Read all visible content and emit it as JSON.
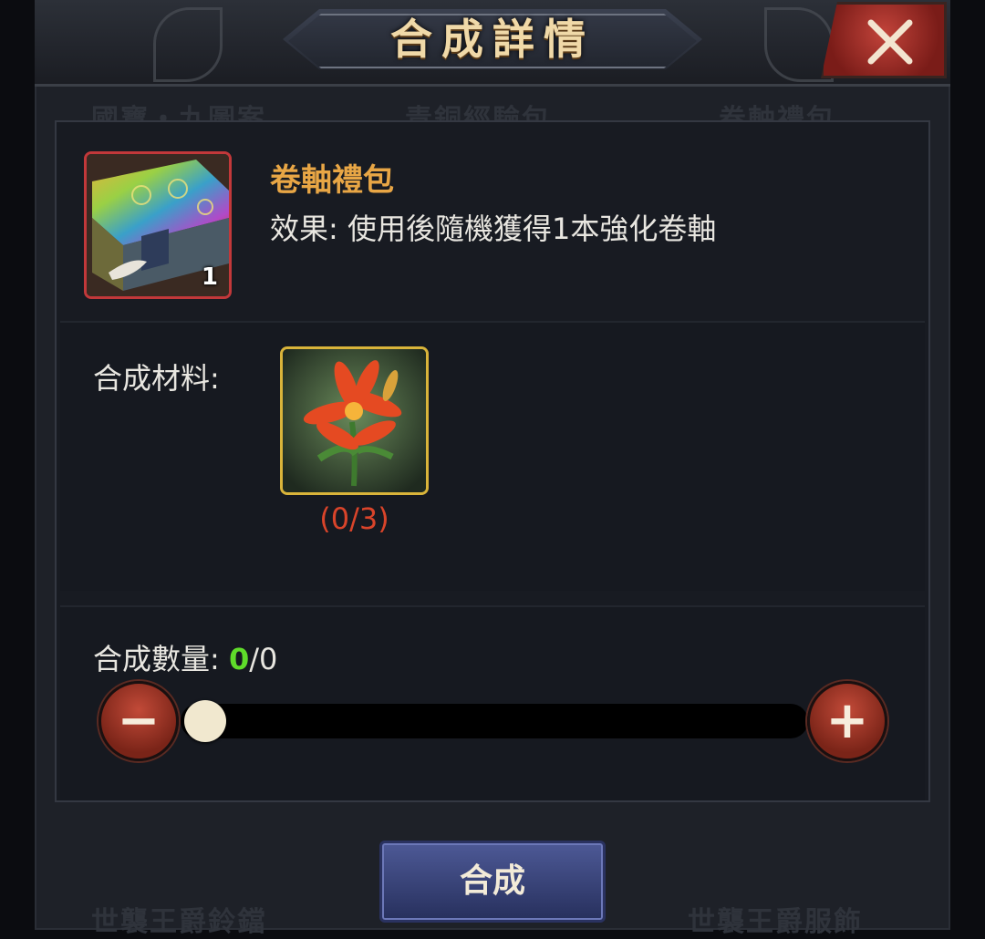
{
  "dialog": {
    "title": "合成詳情",
    "close_icon": "close-x-icon"
  },
  "background_labels": [
    "國寶・九圖案",
    "青銅經驗包",
    "卷軸禮包",
    "世襲王爵鈴鐺",
    "世襲王爵服飾"
  ],
  "result_item": {
    "icon": "scroll-giftbox-icon",
    "count": "1",
    "name": "卷軸禮包",
    "effect": "效果: 使用後隨機獲得1本強化卷軸"
  },
  "materials": {
    "label": "合成材料:",
    "items": [
      {
        "icon": "red-lily-flower-icon",
        "progress": "(0/3)"
      }
    ]
  },
  "quantity": {
    "label": "合成數量:",
    "current": "0",
    "separator_max": "/0",
    "slider_fraction": 0,
    "minus_glyph": "−",
    "plus_glyph": "+"
  },
  "craft_button": {
    "label": "合成"
  },
  "colors": {
    "item_name": "#e8a645",
    "material_missing": "#d9442a",
    "quantity_current": "#5fdc2a",
    "rare_border": "#c2383a",
    "material_border": "#d9b43a"
  }
}
